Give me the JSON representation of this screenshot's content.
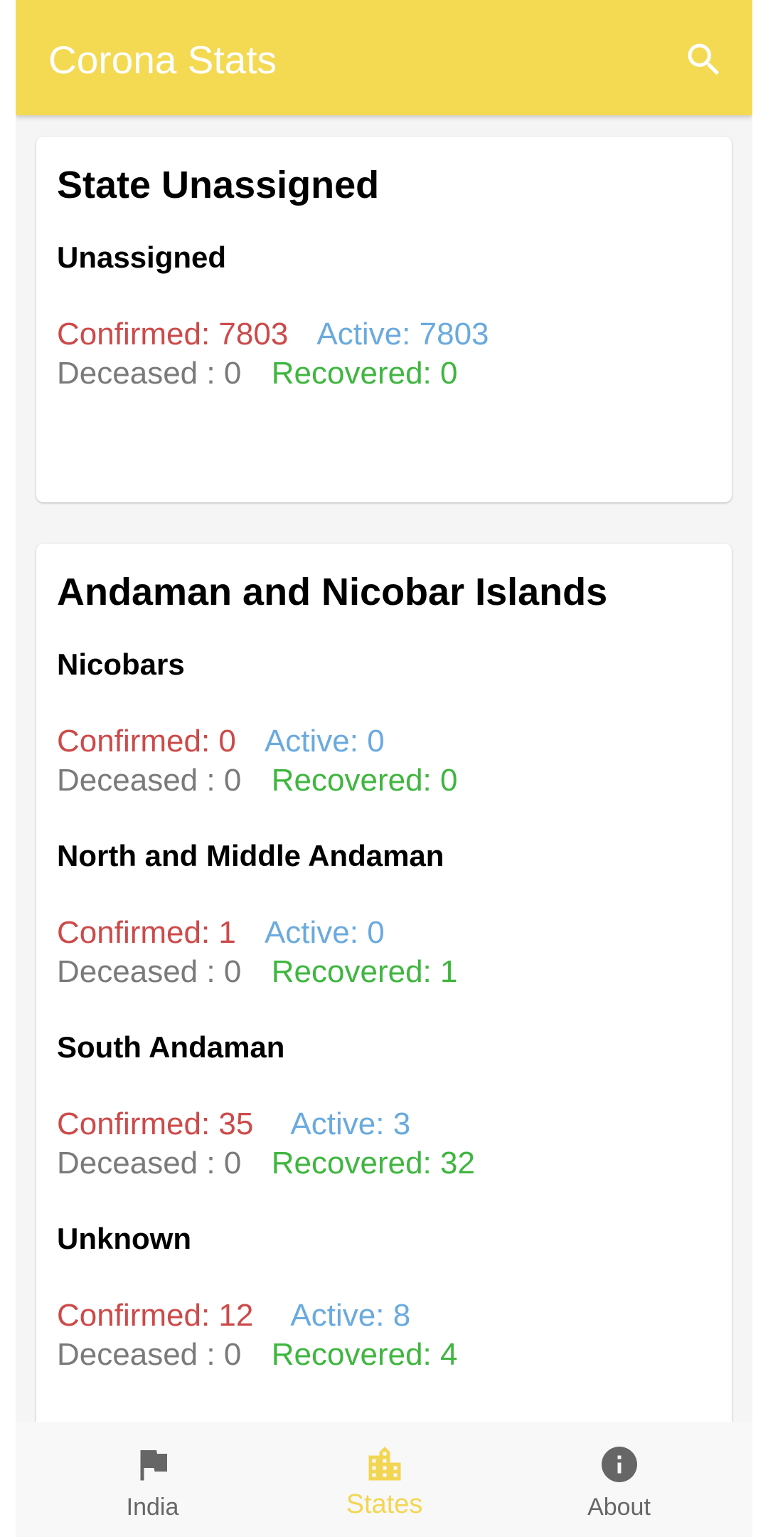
{
  "app": {
    "title": "Corona Stats",
    "accent_color": "#f4d953",
    "search_icon": "search-icon"
  },
  "labels": {
    "confirmed": "Confirmed:",
    "active": "Active:",
    "deceased": "Deceased :",
    "recovered": "Recovered:"
  },
  "colors": {
    "confirmed": "#cd4a4a",
    "active": "#6aaade",
    "deceased": "#7a7a7a",
    "recovered": "#3fb63f"
  },
  "states": [
    {
      "name": "State Unassigned",
      "districts": [
        {
          "name": "Unassigned",
          "confirmed": "7803",
          "active": "7803",
          "deceased": "0",
          "recovered": "0"
        }
      ]
    },
    {
      "name": "Andaman and Nicobar Islands",
      "districts": [
        {
          "name": "Nicobars",
          "confirmed": "0",
          "active": "0",
          "deceased": "0",
          "recovered": "0"
        },
        {
          "name": "North and Middle Andaman",
          "confirmed": "1",
          "active": "0",
          "deceased": "0",
          "recovered": "1"
        },
        {
          "name": "South Andaman",
          "confirmed": "35",
          "active": "3",
          "deceased": "0",
          "recovered": "32"
        },
        {
          "name": "Unknown",
          "confirmed": "12",
          "active": "8",
          "deceased": "0",
          "recovered": "4"
        }
      ]
    }
  ],
  "bottom_nav": {
    "items": [
      {
        "label": "India",
        "icon": "flag-icon"
      },
      {
        "label": "States",
        "icon": "city-icon",
        "selected": true
      },
      {
        "label": "About",
        "icon": "info-icon"
      }
    ]
  }
}
